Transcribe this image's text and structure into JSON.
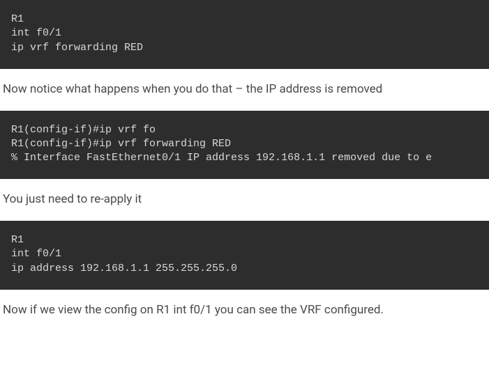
{
  "code1": "R1\nint f0/1\nip vrf forwarding RED",
  "para1": "Now notice what happens when you do that – the IP address is removed",
  "code2": "R1(config-if)#ip vrf fo\nR1(config-if)#ip vrf forwarding RED\n% Interface FastEthernet0/1 IP address 192.168.1.1 removed due to e",
  "para2": "You just need to re-apply it",
  "code3": "R1\nint f0/1\nip address 192.168.1.1 255.255.255.0",
  "para3": "Now if we view the config on R1 int f0/1 you can see the VRF configured."
}
